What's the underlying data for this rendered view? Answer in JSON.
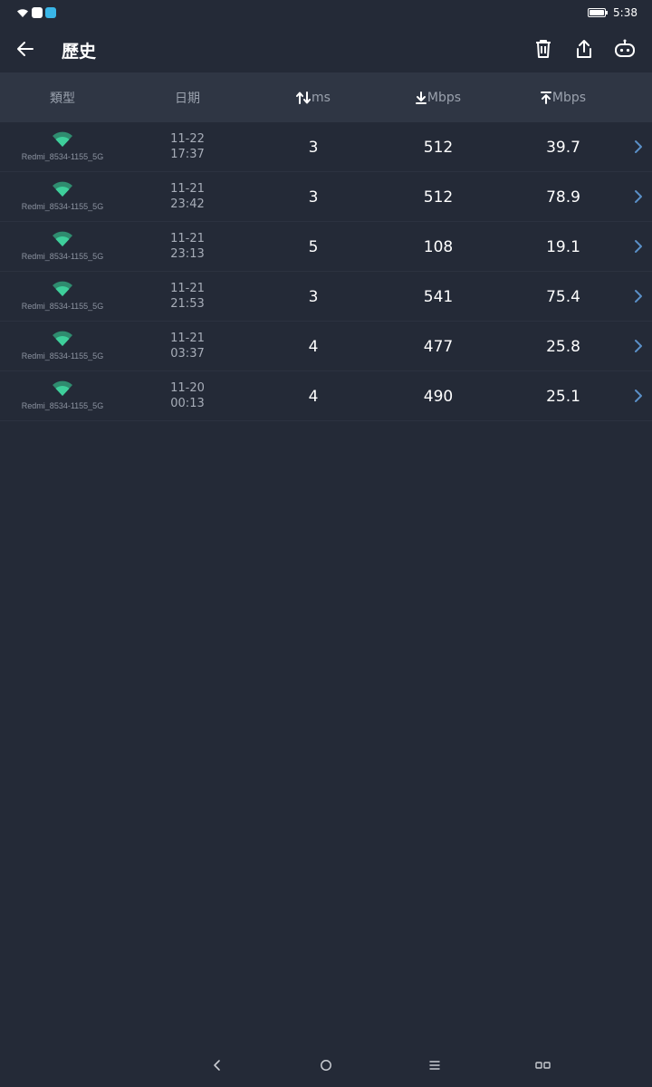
{
  "status_bar": {
    "time": "5:38",
    "icons": [
      "wifi-icon",
      "notification-app-icon",
      "notification-app-icon-2",
      "battery-icon"
    ]
  },
  "app_bar": {
    "title": "歷史",
    "actions": [
      "trash-icon",
      "share-icon",
      "robot-icon"
    ]
  },
  "table": {
    "headers": {
      "type": "類型",
      "date": "日期",
      "ping": "ms",
      "download": "Mbps",
      "upload": "Mbps"
    },
    "rows": [
      {
        "ssid": "Redmi_8534-1155_5G",
        "date": "11-22",
        "time": "17:37",
        "ping": "3",
        "download": "512",
        "upload": "39.7"
      },
      {
        "ssid": "Redmi_8534-1155_5G",
        "date": "11-21",
        "time": "23:42",
        "ping": "3",
        "download": "512",
        "upload": "78.9"
      },
      {
        "ssid": "Redmi_8534-1155_5G",
        "date": "11-21",
        "time": "23:13",
        "ping": "5",
        "download": "108",
        "upload": "19.1"
      },
      {
        "ssid": "Redmi_8534-1155_5G",
        "date": "11-21",
        "time": "21:53",
        "ping": "3",
        "download": "541",
        "upload": "75.4"
      },
      {
        "ssid": "Redmi_8534-1155_5G",
        "date": "11-21",
        "time": "03:37",
        "ping": "4",
        "download": "477",
        "upload": "25.8"
      },
      {
        "ssid": "Redmi_8534-1155_5G",
        "date": "11-20",
        "time": "00:13",
        "ping": "4",
        "download": "490",
        "upload": "25.1"
      }
    ]
  },
  "colors": {
    "background": "#242a37",
    "header_background": "#2f3644",
    "wifi_accent": "#3ecf9b",
    "chevron": "#5a8fc7"
  },
  "nav_bar": {
    "buttons": [
      "back-nav-icon",
      "home-nav-icon",
      "menu-nav-icon",
      "recents-nav-icon"
    ]
  }
}
